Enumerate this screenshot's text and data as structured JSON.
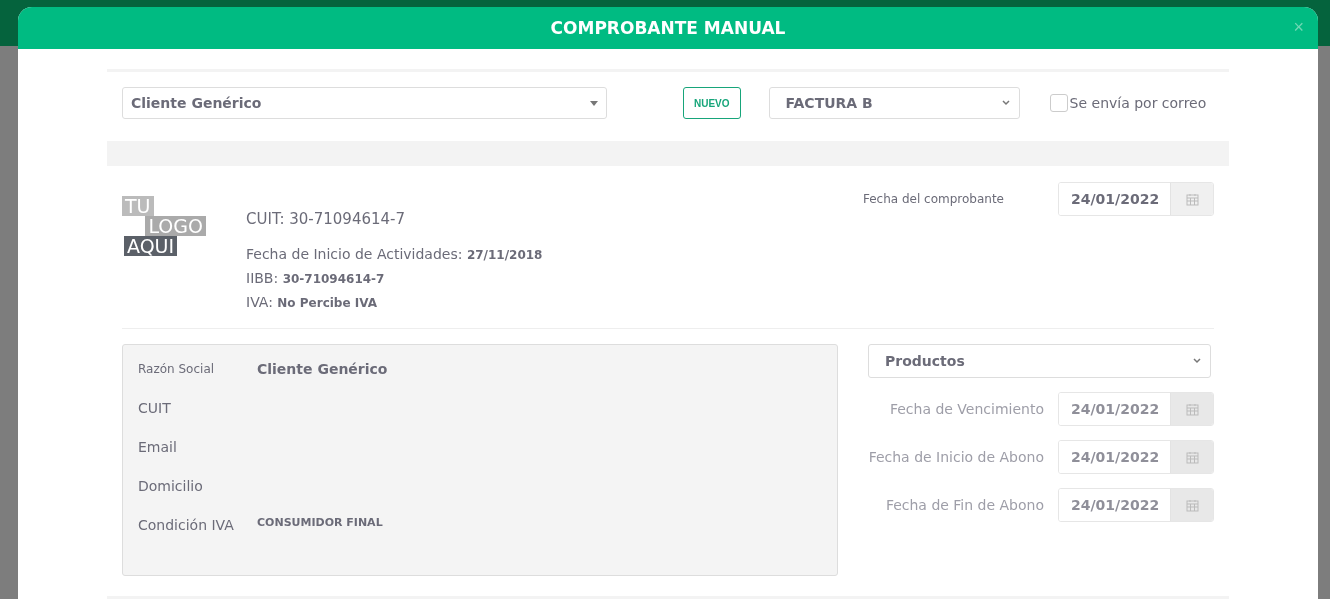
{
  "modal": {
    "title": "COMPROBANTE MANUAL",
    "close": "×"
  },
  "toolbar": {
    "client_select": "Cliente Genérico",
    "new_button": "NUEVO",
    "voucher_type": "FACTURA B",
    "email_checkbox": {
      "label": "Se envía por correo",
      "checked": false
    }
  },
  "issuer": {
    "logo": [
      "TU",
      "LOGO",
      "AQUI"
    ],
    "lines": [
      {
        "label": "CUIT: 30-71094614-7"
      },
      {
        "label": "Fecha de Inicio de Actividades:",
        "value": "27/11/2018"
      },
      {
        "label": "IIBB:",
        "value": "30-71094614-7"
      },
      {
        "label": "IVA:",
        "value": "No Percibe IVA"
      }
    ]
  },
  "voucher_date": {
    "label": "Fecha del comprobante",
    "value": "24/01/2022",
    "disabled": false
  },
  "client": [
    {
      "label": "Razón Social",
      "value": "Cliente Genérico",
      "kind": "name"
    },
    {
      "label": "CUIT",
      "kind": "plain"
    },
    {
      "label": "Email",
      "kind": "plain"
    },
    {
      "label": "Domicilio",
      "kind": "plain"
    },
    {
      "label": "Condición IVA",
      "value": "CONSUMIDOR FINAL",
      "kind": "caps"
    }
  ],
  "concept_select": "Productos",
  "dates": [
    {
      "label": "Fecha de Vencimiento",
      "value": "24/01/2022",
      "disabled": true
    },
    {
      "label": "Fecha de Inicio de Abono",
      "value": "24/01/2022",
      "disabled": true
    },
    {
      "label": "Fecha de Fin de Abono",
      "value": "24/01/2022",
      "disabled": true
    }
  ]
}
